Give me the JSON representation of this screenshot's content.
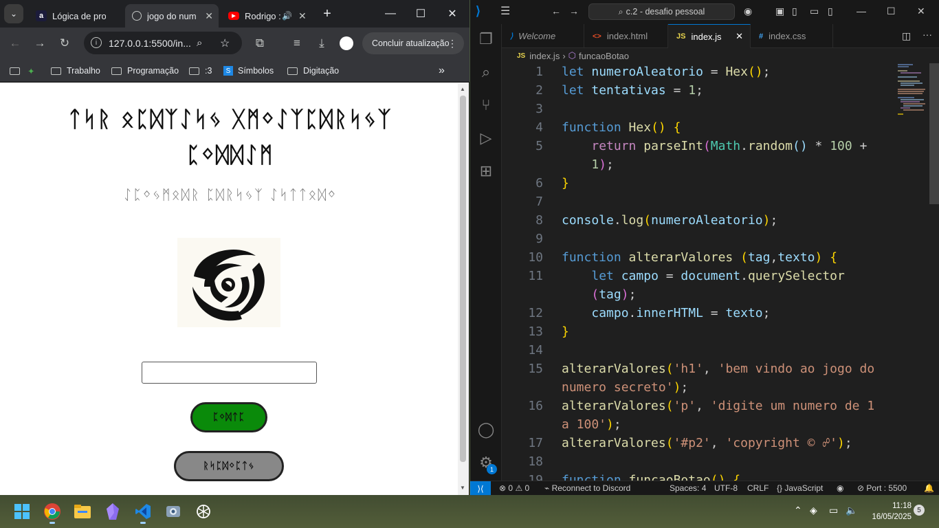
{
  "chrome": {
    "tabs": [
      {
        "title": "Lógica de pro",
        "favicon": "a"
      },
      {
        "title": "jogo do num",
        "favicon": "globe"
      },
      {
        "title": "Rodrigo :",
        "favicon": "youtube"
      }
    ],
    "new_tab": "+",
    "url": "127.0.0.1:5500/in...",
    "update_label": "Concluir atualização",
    "bookmarks": [
      "Trabalho",
      "Programação",
      ":3",
      "Símbolos",
      "Digitação"
    ],
    "more_bookmarks": "»"
  },
  "page": {
    "title_glyphs": "ᛏᛋᚱ ᛟᛈᛞᛉᛇᛋᛃ ᚷᛗᛜᛇᛉᛈᛞᚱᛋᛃᛉ ᛈᛜᛞᛞᛇᛗ",
    "subtitle_glyphs": "ᛇᛈᛜᛃᛗᛟᛞᚱ ᛈᛞᚱᛋᛃᛉ ᛇᛋᛏᛏᛟᛞᛜ",
    "chute_glyphs": "ᛈᛜᛞᛏᛈ",
    "reset_glyphs": "ᚱᛋᛈᛞᛜᛈᛏᛃ",
    "input_value": ""
  },
  "vscode": {
    "search": "c.2 - desafio pessoal",
    "tabs": [
      {
        "label": "Welcome",
        "icon": "vscode"
      },
      {
        "label": "index.html",
        "icon": "<>"
      },
      {
        "label": "index.js",
        "icon": "JS"
      },
      {
        "label": "index.css",
        "icon": "#"
      }
    ],
    "breadcrumb": [
      "index.js",
      "funcaoBotao"
    ],
    "line_numbers": [
      "1",
      "2",
      "3",
      "4",
      "5",
      "",
      "6",
      "7",
      "8",
      "9",
      "10",
      "11",
      "",
      "12",
      "13",
      "14",
      "15",
      "",
      "16",
      "",
      "17",
      "18",
      "19"
    ],
    "status": {
      "errors": "0",
      "warnings": "0",
      "discord": "Reconnect to Discord",
      "spaces": "Spaces: 4",
      "encoding": "UTF-8",
      "eol": "CRLF",
      "language": "JavaScript",
      "port": "Port : 5500"
    }
  },
  "taskbar": {
    "time": "11:18",
    "date": "16/05/2025",
    "notifications": "5"
  },
  "colors": {
    "chute_button": "#0a8a0a",
    "reset_button": "#888888",
    "accent": "#0078d4"
  }
}
